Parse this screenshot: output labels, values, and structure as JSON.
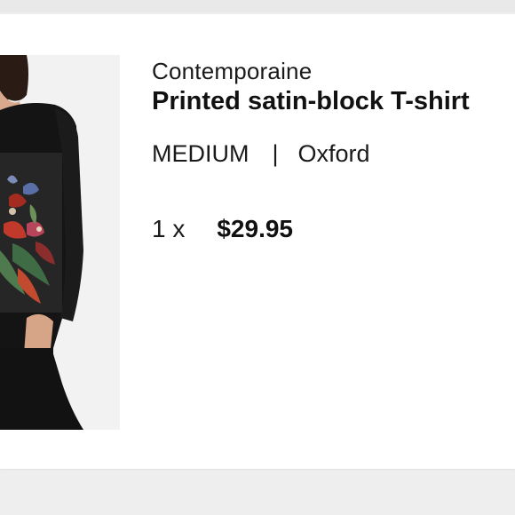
{
  "item": {
    "brand": "Contemporaine",
    "title": "Printed satin-block T-shirt",
    "size": "MEDIUM",
    "separator": "|",
    "color": "Oxford",
    "quantity": "1 x",
    "price": "$29.95"
  },
  "image": {
    "subject": "product-photo",
    "background_color": "#f2f2f2",
    "garment_color": "#111111"
  }
}
